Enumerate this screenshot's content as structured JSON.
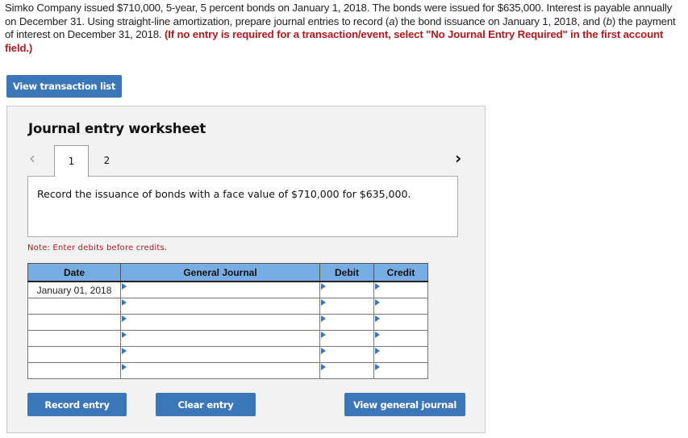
{
  "question": {
    "text_a": "Simko Company issued $710,000, 5-year, 5 percent bonds on January 1, 2018. The bonds were issued for $635,000. Interest is payable annually on December 31. Using straight-line amortization, prepare journal entries to record (",
    "a": "a",
    "text_b": ") the bond issuance on January 1, 2018, and (",
    "b": "b",
    "text_c": ") the payment of interest on December 31, 2018. ",
    "instruction": "(If no entry is required for a transaction/event, select \"No Journal Entry Required\" in the first account field.)"
  },
  "buttons": {
    "view_transaction_list": "View transaction list",
    "record_entry": "Record entry",
    "clear_entry": "Clear entry",
    "view_general_journal": "View general journal"
  },
  "worksheet": {
    "title": "Journal entry worksheet",
    "prev_icon": "‹",
    "next_icon": "›",
    "tabs": [
      {
        "label": "1",
        "active": true
      },
      {
        "label": "2",
        "active": false
      }
    ],
    "description": "Record the issuance of bonds with a face value of $710,000 for $635,000.",
    "note": "Note: Enter debits before credits."
  },
  "table": {
    "headers": [
      "Date",
      "General Journal",
      "Debit",
      "Credit"
    ],
    "rows": [
      {
        "date": "January 01, 2018",
        "account": "",
        "debit": "",
        "credit": ""
      },
      {
        "date": "",
        "account": "",
        "debit": "",
        "credit": ""
      },
      {
        "date": "",
        "account": "",
        "debit": "",
        "credit": ""
      },
      {
        "date": "",
        "account": "",
        "debit": "",
        "credit": ""
      },
      {
        "date": "",
        "account": "",
        "debit": "",
        "credit": ""
      },
      {
        "date": "",
        "account": "",
        "debit": "",
        "credit": ""
      }
    ]
  }
}
